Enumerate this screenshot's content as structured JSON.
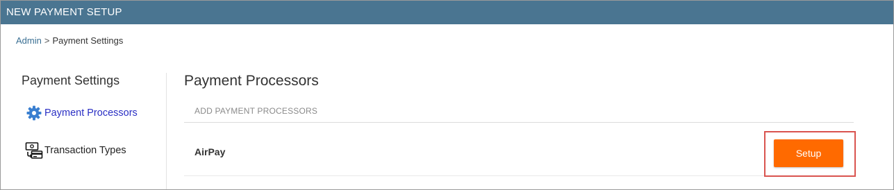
{
  "window": {
    "title": "NEW PAYMENT SETUP"
  },
  "breadcrumb": {
    "root": "Admin",
    "separator": ">",
    "current": "Payment Settings"
  },
  "sidebar": {
    "title": "Payment Settings",
    "items": [
      {
        "label": "Payment Processors",
        "icon": "gear-icon",
        "active": true
      },
      {
        "label": "Transaction Types",
        "icon": "transaction-types-icon",
        "active": false
      }
    ]
  },
  "main": {
    "title": "Payment Processors",
    "section_header": "ADD PAYMENT PROCESSORS",
    "processors": [
      {
        "name": "AirPay",
        "action_label": "Setup"
      }
    ]
  },
  "colors": {
    "titlebar": "#4a7591",
    "link": "#3a6f93",
    "active_item": "#2a2fc4",
    "setup_button": "#ff6a00",
    "highlight_border": "#d9534f"
  }
}
